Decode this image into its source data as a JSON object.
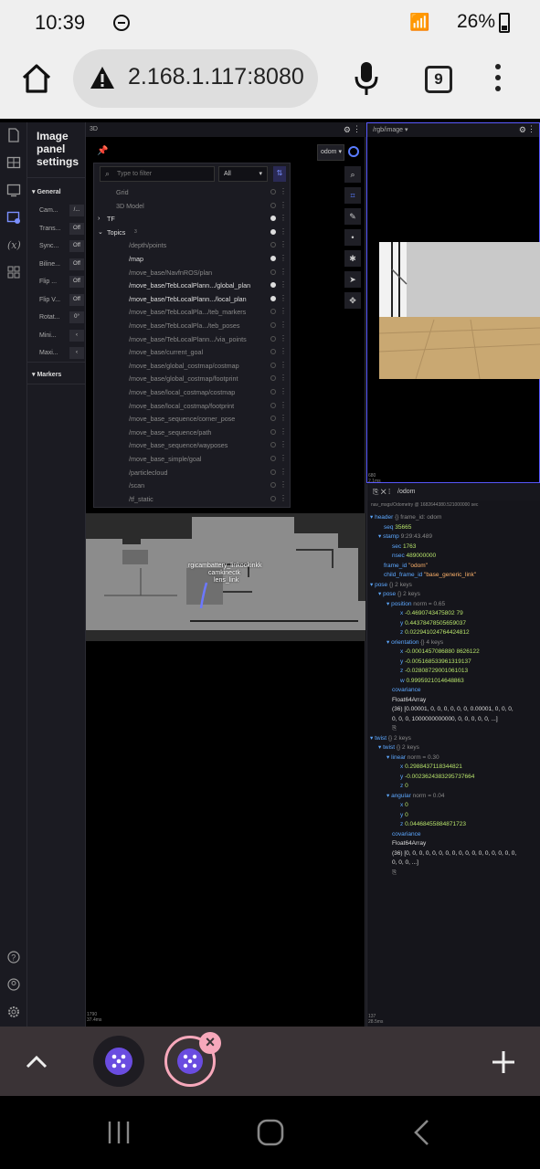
{
  "status_bar": {
    "time": "10:39",
    "signal": "⟟ᵢₗ",
    "battery": "26%"
  },
  "browser": {
    "url": "2.168.1.117:8080",
    "tab_count": "9"
  },
  "settings_panel": {
    "title": "Image panel settings",
    "general_label": "General",
    "rows": [
      {
        "label": "Cam...",
        "value": "/..."
      },
      {
        "label": "Trans...",
        "value": "Off"
      },
      {
        "label": "Sync...",
        "value": "Off"
      },
      {
        "label": "Biline...",
        "value": "Off"
      },
      {
        "label": "Flip ...",
        "value": "Off"
      },
      {
        "label": "Flip V...",
        "value": "Off"
      },
      {
        "label": "Rotat...",
        "value": "0°"
      },
      {
        "label": "Mini...",
        "value": "‹"
      },
      {
        "label": "Maxi...",
        "value": "‹"
      }
    ],
    "markers_label": "Markers"
  },
  "panel_3d": {
    "title": "3D",
    "frame_select": "odom",
    "filter_placeholder": "Type to filter",
    "filter_option": "All",
    "layers": [
      {
        "name": "Grid",
        "indent": 1,
        "state": "off",
        "bright": false
      },
      {
        "name": "3D Model",
        "indent": 1,
        "state": "off",
        "bright": false
      },
      {
        "name": "TF",
        "indent": 0,
        "state": "on",
        "bright": true,
        "arrow": "›"
      },
      {
        "name": "Topics",
        "indent": 0,
        "state": "on",
        "bright": true,
        "arrow": "⌄",
        "badge": "3"
      },
      {
        "name": "/depth/points",
        "indent": 2,
        "state": "off",
        "bright": false
      },
      {
        "name": "/map",
        "indent": 2,
        "state": "on",
        "bright": true
      },
      {
        "name": "/move_base/NavfnROS/plan",
        "indent": 2,
        "state": "off",
        "bright": false
      },
      {
        "name": "/move_base/TebLocalPlann.../global_plan",
        "indent": 2,
        "state": "on",
        "bright": true
      },
      {
        "name": "/move_base/TebLocalPlann.../local_plan",
        "indent": 2,
        "state": "on",
        "bright": true
      },
      {
        "name": "/move_base/TebLocalPla.../teb_markers",
        "indent": 2,
        "state": "off",
        "bright": false
      },
      {
        "name": "/move_base/TebLocalPla.../teb_poses",
        "indent": 2,
        "state": "off",
        "bright": false
      },
      {
        "name": "/move_base/TebLocalPlann.../via_points",
        "indent": 2,
        "state": "off",
        "bright": false
      },
      {
        "name": "/move_base/current_goal",
        "indent": 2,
        "state": "off",
        "bright": false
      },
      {
        "name": "/move_base/global_costmap/costmap",
        "indent": 2,
        "state": "off",
        "bright": false
      },
      {
        "name": "/move_base/global_costmap/footprint",
        "indent": 2,
        "state": "off",
        "bright": false
      },
      {
        "name": "/move_base/local_costmap/costmap",
        "indent": 2,
        "state": "off",
        "bright": false
      },
      {
        "name": "/move_base/local_costmap/footprint",
        "indent": 2,
        "state": "off",
        "bright": false
      },
      {
        "name": "/move_base_sequence/corner_pose",
        "indent": 2,
        "state": "off",
        "bright": false
      },
      {
        "name": "/move_base_sequence/path",
        "indent": 2,
        "state": "off",
        "bright": false
      },
      {
        "name": "/move_base_sequence/wayposes",
        "indent": 2,
        "state": "off",
        "bright": false
      },
      {
        "name": "/move_base_simple/goal",
        "indent": 2,
        "state": "off",
        "bright": false
      },
      {
        "name": "/particlecloud",
        "indent": 2,
        "state": "off",
        "bright": false
      },
      {
        "name": "/scan",
        "indent": 2,
        "state": "off",
        "bright": false
      },
      {
        "name": "/tf_static",
        "indent": 2,
        "state": "off",
        "bright": false
      }
    ],
    "map_labels": [
      "rgicambattery_linkookinkk",
      "camkinectk",
      "lens_link"
    ],
    "footer": [
      "1790",
      "37.4ms"
    ]
  },
  "panel_image": {
    "topic": "/rgb/image",
    "footer": [
      "680",
      "2.1ms"
    ]
  },
  "panel_raw": {
    "topic": "/odom",
    "subtitle": "nav_msgs/Odometry @ 1682644380.521000000 sec",
    "tree": [
      {
        "d": 0,
        "t": "▾",
        "k": "header",
        "m": "{} frame_id: odom"
      },
      {
        "d": 1,
        "k": "seq",
        "n": "35665"
      },
      {
        "d": 1,
        "t": "▾",
        "k": "stamp",
        "m": "9:29:43.489"
      },
      {
        "d": 2,
        "k": "sec",
        "n": "1763"
      },
      {
        "d": 2,
        "k": "nsec",
        "n": "489000000"
      },
      {
        "d": 1,
        "k": "frame_id",
        "s": "\"odom\""
      },
      {
        "d": 1,
        "k": "child_frame_id",
        "s": "\"base_generic_link\""
      },
      {
        "d": 0,
        "t": "▾",
        "k": "pose",
        "m": "{} 2 keys"
      },
      {
        "d": 1,
        "t": "▾",
        "k": "pose",
        "m": "{} 2 keys"
      },
      {
        "d": 2,
        "t": "▾",
        "k": "position",
        "m": "norm = 0.65"
      },
      {
        "d": 3,
        "k": "x",
        "n": "-0.4690743475802 79"
      },
      {
        "d": 3,
        "k": "y",
        "n": "0.44378478505659037"
      },
      {
        "d": 3,
        "k": "z",
        "n": "0.022941024764424812"
      },
      {
        "d": 2,
        "t": "▾",
        "k": "orientation",
        "m": "{} 4 keys"
      },
      {
        "d": 3,
        "k": "x",
        "n": "-0.0001457086880 8626122"
      },
      {
        "d": 3,
        "k": "y",
        "n": "-0.005168533961319137"
      },
      {
        "d": 3,
        "k": "z",
        "n": "-0.02808729001061013"
      },
      {
        "d": 3,
        "k": "w",
        "n": "0.9995921014648863"
      },
      {
        "d": 2,
        "k": "covariance",
        "m": ""
      },
      {
        "d": 2,
        "w": "Float64Array"
      },
      {
        "d": 2,
        "w": "(36) [0.00001, 0, 0, 0, 0, 0, 0, 0.00001, 0, 0, 0,"
      },
      {
        "d": 2,
        "w": "0, 0, 0, 1000000000000, 0, 0, 0, 0, 0, ...]"
      },
      {
        "d": 2,
        "m": "⎘"
      },
      {
        "d": 0,
        "t": "▾",
        "k": "twist",
        "m": "{} 2 keys"
      },
      {
        "d": 1,
        "t": "▾",
        "k": "twist",
        "m": "{} 2 keys"
      },
      {
        "d": 2,
        "t": "▾",
        "k": "linear",
        "m": "norm = 0.30"
      },
      {
        "d": 3,
        "k": "x",
        "n": "0.2988437118344821"
      },
      {
        "d": 3,
        "k": "y",
        "n": "-0.0023624383295737664"
      },
      {
        "d": 3,
        "k": "z",
        "n": "0"
      },
      {
        "d": 2,
        "t": "▾",
        "k": "angular",
        "m": "norm = 0.04"
      },
      {
        "d": 3,
        "k": "x",
        "n": "0"
      },
      {
        "d": 3,
        "k": "y",
        "n": "0"
      },
      {
        "d": 3,
        "k": "z",
        "n": "0.04468455884871723"
      },
      {
        "d": 2,
        "k": "covariance",
        "m": ""
      },
      {
        "d": 2,
        "w": "Float64Array"
      },
      {
        "d": 2,
        "w": "(36) [0, 0, 0, 0, 0, 0, 0, 0, 0, 0, 0, 0, 0, 0, 0, 0, 0,"
      },
      {
        "d": 2,
        "w": "0, 0, 0, ...]"
      },
      {
        "d": 2,
        "m": "⎘"
      }
    ],
    "footer": [
      "137",
      "28.5ms"
    ]
  },
  "colors": {
    "accent": "#5a7cff",
    "close_badge": "#f7a8bb",
    "tabbar": "#3a3336"
  }
}
